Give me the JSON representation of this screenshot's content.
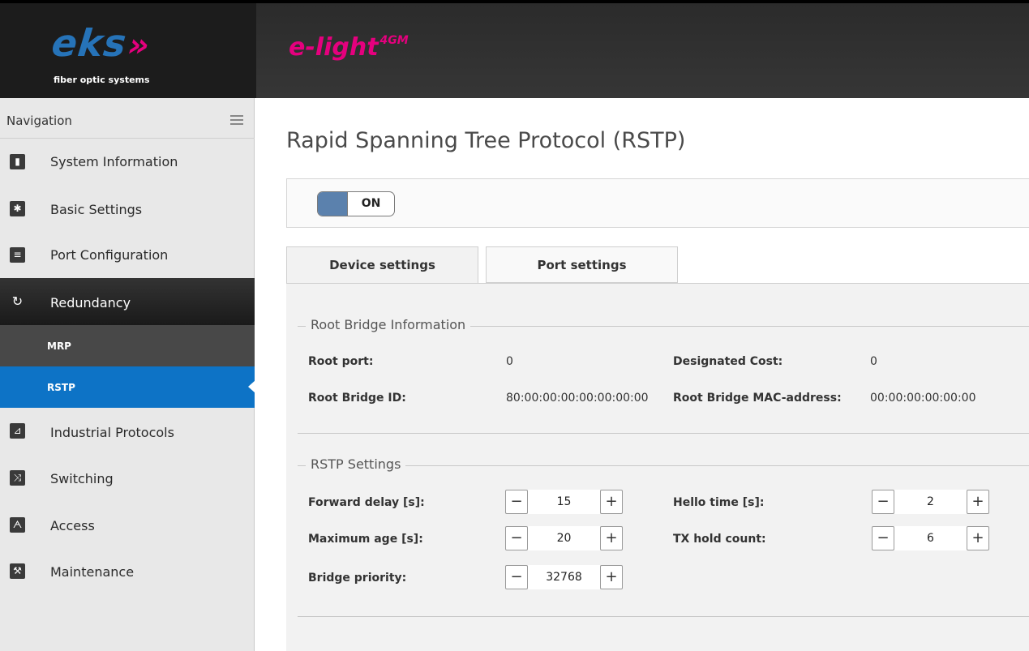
{
  "brand": {
    "logo": "eks",
    "logo_arrows": "»",
    "subtitle": "fiber optic systems"
  },
  "product": {
    "name": "e-light",
    "superscript": "4GM"
  },
  "sidebar": {
    "header": "Navigation",
    "items": [
      {
        "label": "System Information",
        "icon": "chart-icon"
      },
      {
        "label": "Basic Settings",
        "icon": "gear-icon"
      },
      {
        "label": "Port Configuration",
        "icon": "port-icon"
      },
      {
        "label": "Redundancy",
        "icon": "redundancy-icon",
        "active": true
      },
      {
        "label": "Industrial Protocols",
        "icon": "protocol-icon"
      },
      {
        "label": "Switching",
        "icon": "shuffle-icon"
      },
      {
        "label": "Access",
        "icon": "lock-icon"
      },
      {
        "label": "Maintenance",
        "icon": "wrench-icon"
      }
    ],
    "subitems": [
      {
        "label": "MRP"
      },
      {
        "label": "RSTP",
        "selected": true
      }
    ]
  },
  "main": {
    "title": "Rapid Spanning Tree Protocol (RSTP)",
    "toggle": {
      "state": "ON"
    },
    "tabs": [
      {
        "label": "Device settings",
        "active": true
      },
      {
        "label": "Port settings"
      }
    ],
    "root_bridge": {
      "legend": "Root Bridge Information",
      "root_port_label": "Root port:",
      "root_port_value": "0",
      "designated_cost_label": "Designated Cost:",
      "designated_cost_value": "0",
      "root_bridge_id_label": "Root Bridge ID:",
      "root_bridge_id_value": "80:00:00:00:00:00:00:00",
      "root_bridge_mac_label": "Root Bridge MAC-address:",
      "root_bridge_mac_value": "00:00:00:00:00:00"
    },
    "rstp": {
      "legend": "RSTP Settings",
      "forward_delay_label": "Forward delay [s]:",
      "forward_delay_value": "15",
      "hello_time_label": "Hello time [s]:",
      "hello_time_value": "2",
      "max_age_label": "Maximum age [s]:",
      "max_age_value": "20",
      "tx_hold_label": "TX hold count:",
      "tx_hold_value": "6",
      "bridge_priority_label": "Bridge priority:",
      "bridge_priority_value": "32768",
      "minus": "−",
      "plus": "+"
    }
  },
  "colors": {
    "accent_blue": "#0d73c6",
    "brand_magenta": "#e5007e",
    "logo_blue": "#2673b8"
  }
}
